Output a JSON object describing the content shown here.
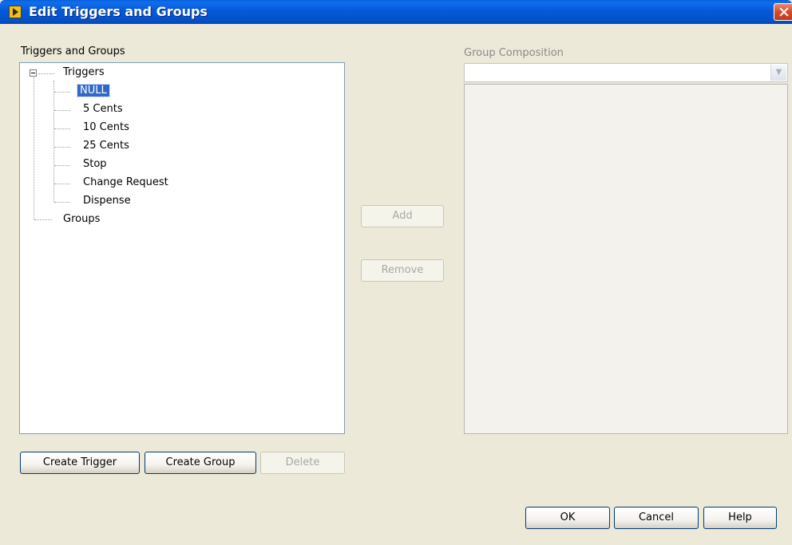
{
  "window": {
    "title": "Edit Triggers and Groups"
  },
  "left": {
    "label": "Triggers and Groups",
    "tree": {
      "root": "Triggers",
      "items": [
        "NULL",
        "5 Cents",
        "10 Cents",
        "25 Cents",
        "Stop",
        "Change Request",
        "Dispense"
      ],
      "selected": "NULL",
      "groups": "Groups"
    },
    "create_trigger": "Create Trigger",
    "create_group": "Create Group",
    "delete": "Delete"
  },
  "middle": {
    "add": "Add",
    "remove": "Remove"
  },
  "right": {
    "label": "Group Composition",
    "combo_value": ""
  },
  "footer": {
    "ok": "OK",
    "cancel": "Cancel",
    "help": "Help"
  },
  "colors": {
    "title_bar": "#0352c8",
    "selection": "#316ac5",
    "dialog_bg": "#ece9d8"
  }
}
